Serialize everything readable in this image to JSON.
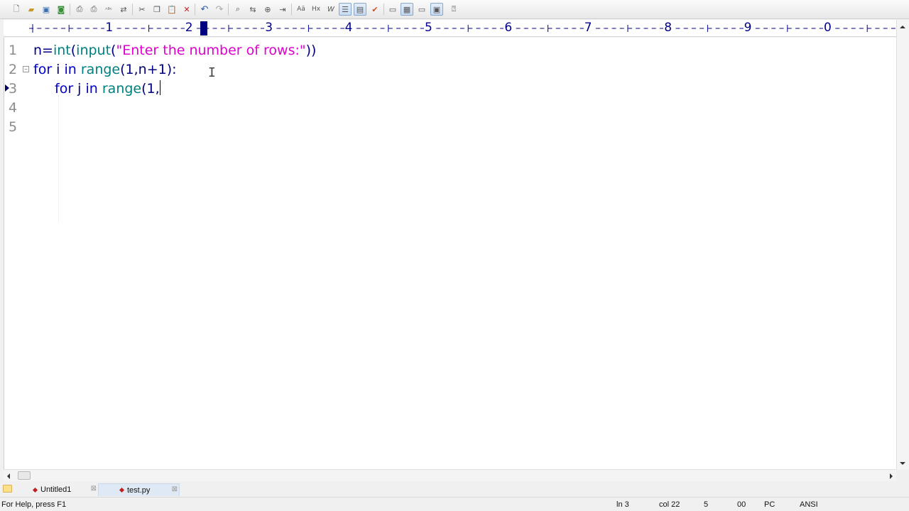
{
  "toolbar": {
    "buttons": [
      {
        "icon": "new-file-icon"
      },
      {
        "icon": "open-folder-icon"
      },
      {
        "icon": "save-icon"
      },
      {
        "icon": "save-all-icon"
      },
      {
        "icon": "print-preview-icon"
      },
      {
        "icon": "print-icon"
      },
      {
        "icon": "spell-check-icon"
      },
      {
        "icon": "compare-icon"
      },
      {
        "icon": "cut-icon"
      },
      {
        "icon": "copy-icon"
      },
      {
        "icon": "paste-icon"
      },
      {
        "icon": "delete-icon"
      },
      {
        "icon": "undo-icon"
      },
      {
        "icon": "redo-icon"
      },
      {
        "icon": "find-icon"
      },
      {
        "icon": "replace-icon"
      },
      {
        "icon": "find-in-files-icon"
      },
      {
        "icon": "goto-icon"
      },
      {
        "icon": "uppercase-icon"
      },
      {
        "icon": "hex-icon"
      },
      {
        "icon": "word-wrap-icon"
      },
      {
        "icon": "line-numbers-icon"
      },
      {
        "icon": "column-mode-icon"
      },
      {
        "icon": "checkmark-icon"
      },
      {
        "icon": "window-list-icon"
      },
      {
        "icon": "tile-icon"
      },
      {
        "icon": "cascade-icon"
      },
      {
        "icon": "output-window-icon"
      },
      {
        "icon": "help-icon"
      }
    ]
  },
  "ruler": {
    "labels": [
      "1",
      "2",
      "3",
      "4",
      "5",
      "6",
      "7",
      "8",
      "9",
      "0"
    ]
  },
  "editor": {
    "line_numbers": [
      "1",
      "2",
      "3",
      "4",
      "5"
    ],
    "line1": {
      "p1": "n=",
      "p2": "int",
      "p3": "(",
      "p4": "input",
      "p5": "(",
      "p6": "\"Enter the number of rows:\"",
      "p7": "))"
    },
    "line2": {
      "p1": "for",
      "p2": " i ",
      "p3": "in",
      "p4": " ",
      "p5": "range",
      "p6": "(",
      "p7": "1",
      "p8": ",n+",
      "p9": "1",
      "p10": "):"
    },
    "line3": {
      "p1": "for",
      "p2": " j ",
      "p3": "in",
      "p4": " ",
      "p5": "range",
      "p6": "(",
      "p7": "1",
      "p8": ","
    }
  },
  "tabs": [
    {
      "label": "Untitled1",
      "active": false
    },
    {
      "label": "test.py",
      "active": true
    }
  ],
  "statusbar": {
    "help": "For Help, press F1",
    "line": "ln 3",
    "col": "col 22",
    "lines": "5",
    "mode": "00",
    "eol": "PC",
    "encoding": "ANSI"
  },
  "colors": {
    "keyword": "#0000cd",
    "builtin": "#008080",
    "string": "#e000d0",
    "number": "#000080",
    "ruler_numbers": "#00008b"
  }
}
